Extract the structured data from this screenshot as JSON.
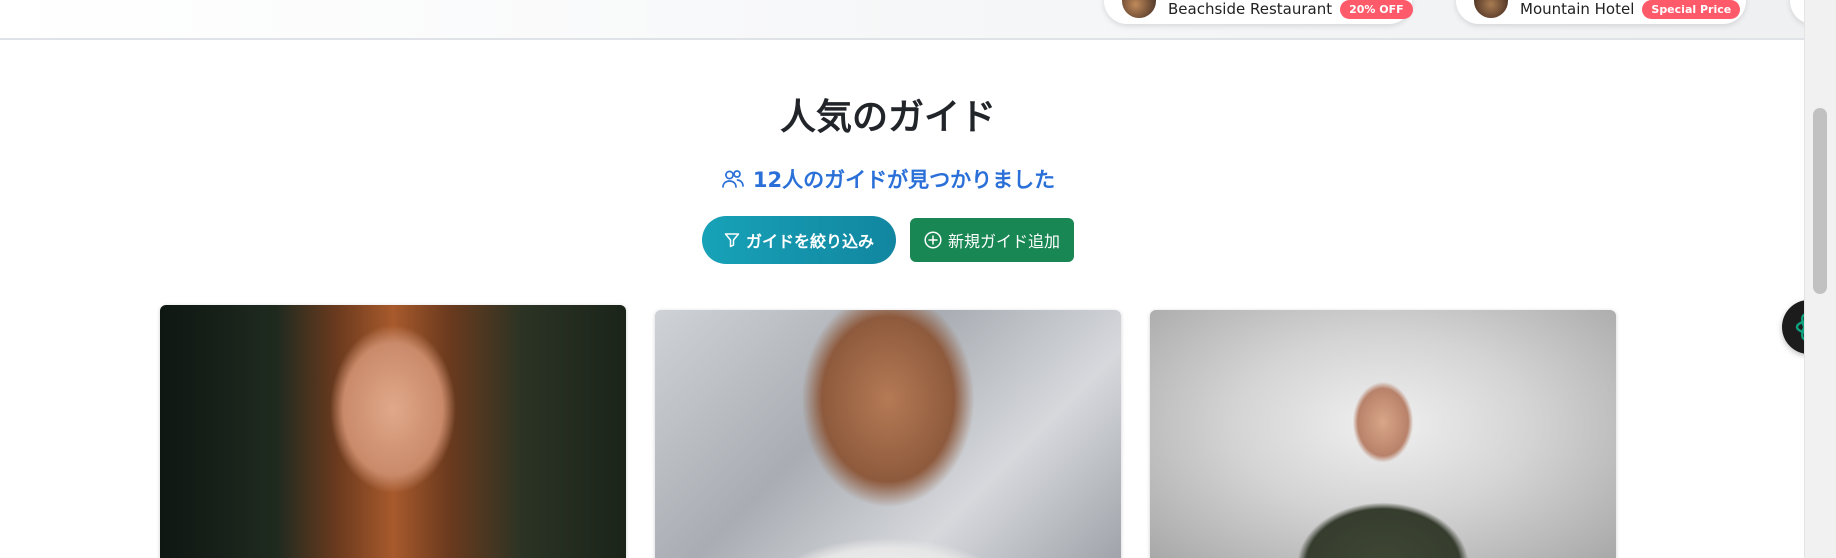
{
  "promos": [
    {
      "name": "Beachside Restaurant",
      "badge": "20% OFF"
    },
    {
      "name": "Mountain Hotel",
      "badge": "Special Price"
    }
  ],
  "section": {
    "title": "人気のガイド",
    "found_text": "12人のガイドが見つかりました"
  },
  "buttons": {
    "filter_label": "ガイドを絞り込み",
    "add_label": "新規ガイド追加"
  },
  "guides": [
    {
      "photo_alt": "guide-1"
    },
    {
      "photo_alt": "guide-2"
    },
    {
      "photo_alt": "guide-3"
    }
  ],
  "colors": {
    "accent_blue": "#2a70d8",
    "filter_button": "#17a2b8",
    "add_button": "#198754",
    "badge": "#ff5a6a",
    "assistant_icon": "#10a37f"
  }
}
